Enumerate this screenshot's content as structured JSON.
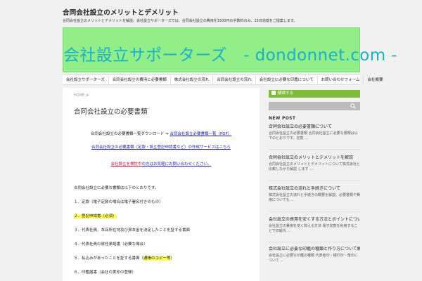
{
  "header": {
    "site_title": "合同会社設立のメリットとデメリット",
    "site_desc": "合同会社設立のメリットとデメリットを解説。会社設立サポーターズでは、合同会社設立の費用を1500円の手数料のみ、15日完成をご提案します。"
  },
  "banner": {
    "text": "会社設立サポーターズ　- dondonnet.com -",
    "bg_color": "#91ee89",
    "text_color": "#1ab2c4"
  },
  "gnav": {
    "items": [
      "会社設立サポーターズ",
      "合同会社設立の費用と必要書類",
      "株式会社設立の流れ",
      "合同会社設立の流れ",
      "会社設立に必要な印鑑について",
      "お問い合わせフォーム",
      "会社概要"
    ]
  },
  "main": {
    "breadcrumb_home": "HOME",
    "breadcrumb_sep": ">",
    "post_title": "合同会社設立の必要書類",
    "line1_pre": "合同会社設立の必要書類一覧ダウンロード ⇒ ",
    "line1_link": "合同会社設立必要書類一覧（PDF）",
    "line2_link": "合同会社設立の必要書類（定款・設立登記申請書など）の作成サービスはこちら",
    "line3_red": "会社設立を検討中",
    "line3_blue": "の方はお気軽にお問い合わせください。",
    "body_lines": [
      "合同会社設立に必要な書類は以下のとおりです。",
      "１．定款（電子定款の場合は電子署名付きのもの）",
      "２．登記申請書（必須）",
      "３．代表社員、本店所在地及び資本金を決定したことを証する書面",
      "４．代表社員の就任承諾書（必要な場合）",
      "５．払込みがあったことを証する書面（通帳のコピー等）",
      "６．印鑑届書（会社の実印の登録）"
    ],
    "highlight_1": "２．登記申請書（必須）",
    "line6_pre": "５．払込みがあったことを証する書面（",
    "line6_hl": "通帳のコピー等",
    "line6_post": "）"
  },
  "sidebar": {
    "rss_label": "購読する",
    "search_placeholder": "",
    "new_post_heading": "NEW POST",
    "posts": [
      {
        "title": "合同会社設立の必要書類について",
        "excerpt": "合同会社設立の必要書類 合同会社設立に必要な書類は以下のとおりです。定款 ..."
      },
      {
        "title": "合同会社設立のメリットとデメリットを解説",
        "excerpt": "合同会社設立のメリットとデメリットについて株式会社と比較しながら解説 します ..."
      },
      {
        "title": "株式会社設立の流れと手続きについて",
        "excerpt": "株式会社設立の流れと手続きの概要を解説。必要書類や費用についても ..."
      },
      {
        "title": "会社設立の費用を安くする方法とポイントについて",
        "excerpt": "会社設立の費用を安く抑える方法 電子定款を利用することで印紙代 ..."
      },
      {
        "title": "会社設立に必要な印鑑の種類と作り方について解説",
        "excerpt": "会社設立に必要な印鑑の種類 代表者印・銀行印・角印について ..."
      }
    ]
  }
}
